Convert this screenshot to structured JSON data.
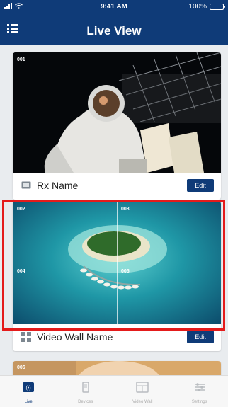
{
  "status_bar": {
    "time": "9:41 AM",
    "battery": "100%"
  },
  "nav": {
    "title": "Live View",
    "menu_icon": "list-icon"
  },
  "cards": [
    {
      "type": "rx",
      "label": "Rx Name",
      "edit_label": "Edit",
      "channel": "001",
      "icon": "monitor-icon"
    },
    {
      "type": "video-wall",
      "label": "Video Wall Name",
      "edit_label": "Edit",
      "channels": [
        "002",
        "003",
        "004",
        "005"
      ],
      "icon": "grid-icon",
      "highlighted": true
    },
    {
      "type": "rx",
      "channel": "006"
    }
  ],
  "tab_bar": {
    "tabs": [
      {
        "label": "Live",
        "icon": "live-view-icon",
        "active": true
      },
      {
        "label": "Devices",
        "icon": "device-icon",
        "active": false
      },
      {
        "label": "Video Wall",
        "icon": "video-wall-icon",
        "active": false
      },
      {
        "label": "Settings",
        "icon": "settings-icon",
        "active": false
      }
    ]
  },
  "colors": {
    "brand": "#0f3b78",
    "highlight": "#e41b1b",
    "background": "#e9ecef"
  }
}
